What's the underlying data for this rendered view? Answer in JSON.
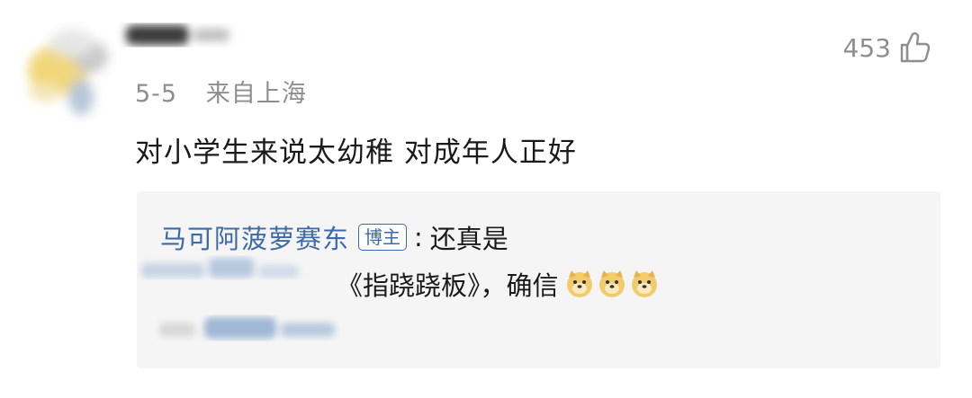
{
  "comment": {
    "date": "5-5",
    "location": "来自上海",
    "like_count": "453",
    "text": "对小学生来说太幼稚 对成年人正好"
  },
  "reply": {
    "author": "马可阿菠萝赛东",
    "badge": "博主",
    "colon": ":",
    "line1_text": "还真是",
    "line2_text": "《指跷跷板》，确信",
    "emojis": [
      "doge-emoji",
      "doge-emoji",
      "doge-emoji"
    ]
  },
  "colors": {
    "author_blue": "#3d6aa6",
    "meta_gray": "#8e8e8e",
    "reply_bg": "#f5f5f5"
  }
}
